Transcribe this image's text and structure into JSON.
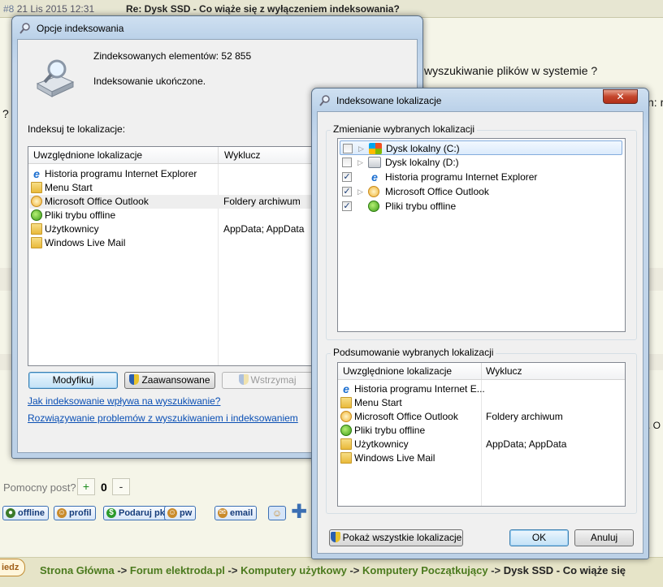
{
  "forum": {
    "post_number": "#8",
    "post_date": "21 Lis 2015 12:31",
    "post_title": "Re: Dysk SSD - Co wiąże się z wyłączeniem indeksowania?",
    "text_question": "wyszukiwanie plików w systemie ?",
    "text_fragment": "n: r",
    "text_question_mark": "?",
    "text_right_dot": ". O",
    "helpful_label": "Pomocny post?",
    "vote_plus": "+",
    "vote_count": "0",
    "vote_minus": "-",
    "userbar": [
      "offline",
      "profil",
      "Podaruj pkt",
      "pw",
      "email"
    ],
    "pill_label": "iedz",
    "breadcrumb": {
      "home": "Strona Główna",
      "sep": " -> ",
      "forum": "Forum elektroda.pl",
      "computers": "Komputery użytkowy",
      "beginners": "Komputery Początkujący",
      "topic": "Dysk SSD - Co wiąże się"
    }
  },
  "indexing_options": {
    "title": "Opcje indeksowania",
    "indexed_count": "Zindeksowanych elementów: 52 855",
    "status": "Indeksowanie ukończone.",
    "index_locations_label": "Indeksuj te lokalizacje:",
    "col_included": "Uwzględnione lokalizacje",
    "col_exclude": "Wyklucz",
    "rows": [
      {
        "name": "Historia programu Internet Explorer",
        "exclude": "",
        "icon": "ie-icon"
      },
      {
        "name": "Menu Start",
        "exclude": "",
        "icon": "folder-icon"
      },
      {
        "name": "Microsoft Office Outlook",
        "exclude": "Foldery archiwum",
        "icon": "outlook-icon"
      },
      {
        "name": "Pliki trybu offline",
        "exclude": "",
        "icon": "offline-files-icon"
      },
      {
        "name": "Użytkownicy",
        "exclude": "AppData; AppData",
        "icon": "folder-icon"
      },
      {
        "name": "Windows Live Mail",
        "exclude": "",
        "icon": "folder-icon"
      }
    ],
    "modify_button": "Modyfikuj",
    "advanced_button": "Zaawansowane",
    "pause_button": "Wstrzymaj",
    "link_search_effect": "Jak indeksowanie wpływa na wyszukiwanie?",
    "link_troubleshoot": "Rozwiązywanie problemów z wyszukiwaniem i indeksowaniem"
  },
  "indexed_locations": {
    "title": "Indeksowane lokalizacje",
    "close_label": "✕",
    "change_group_label": "Zmienianie wybranych lokalizacji",
    "tree": [
      {
        "name": "Dysk lokalny (C:)",
        "checked": false,
        "expander": "▷",
        "icon": "windows-drive-icon"
      },
      {
        "name": "Dysk lokalny (D:)",
        "checked": false,
        "expander": "▷",
        "icon": "drive-icon"
      },
      {
        "name": "Historia programu Internet Explorer",
        "checked": true,
        "expander": "",
        "icon": "ie-icon"
      },
      {
        "name": "Microsoft Office Outlook",
        "checked": true,
        "expander": "▷",
        "icon": "outlook-icon"
      },
      {
        "name": "Pliki trybu offline",
        "checked": true,
        "expander": "",
        "icon": "offline-files-icon"
      }
    ],
    "summary_group_label": "Podsumowanie wybranych lokalizacji",
    "col_included": "Uwzględnione lokalizacje",
    "col_exclude": "Wyklucz",
    "summary_rows": [
      {
        "name": "Historia programu Internet E...",
        "exclude": "",
        "icon": "ie-icon"
      },
      {
        "name": "Menu Start",
        "exclude": "",
        "icon": "folder-icon"
      },
      {
        "name": "Microsoft Office Outlook",
        "exclude": "Foldery archiwum",
        "icon": "outlook-icon"
      },
      {
        "name": "Pliki trybu offline",
        "exclude": "",
        "icon": "offline-files-icon"
      },
      {
        "name": "Użytkownicy",
        "exclude": "AppData; AppData",
        "icon": "folder-icon"
      },
      {
        "name": "Windows Live Mail",
        "exclude": "",
        "icon": "folder-icon"
      }
    ],
    "show_all_button": "Pokaż wszystkie lokalizacje",
    "ok_button": "OK",
    "cancel_button": "Anuluj"
  }
}
